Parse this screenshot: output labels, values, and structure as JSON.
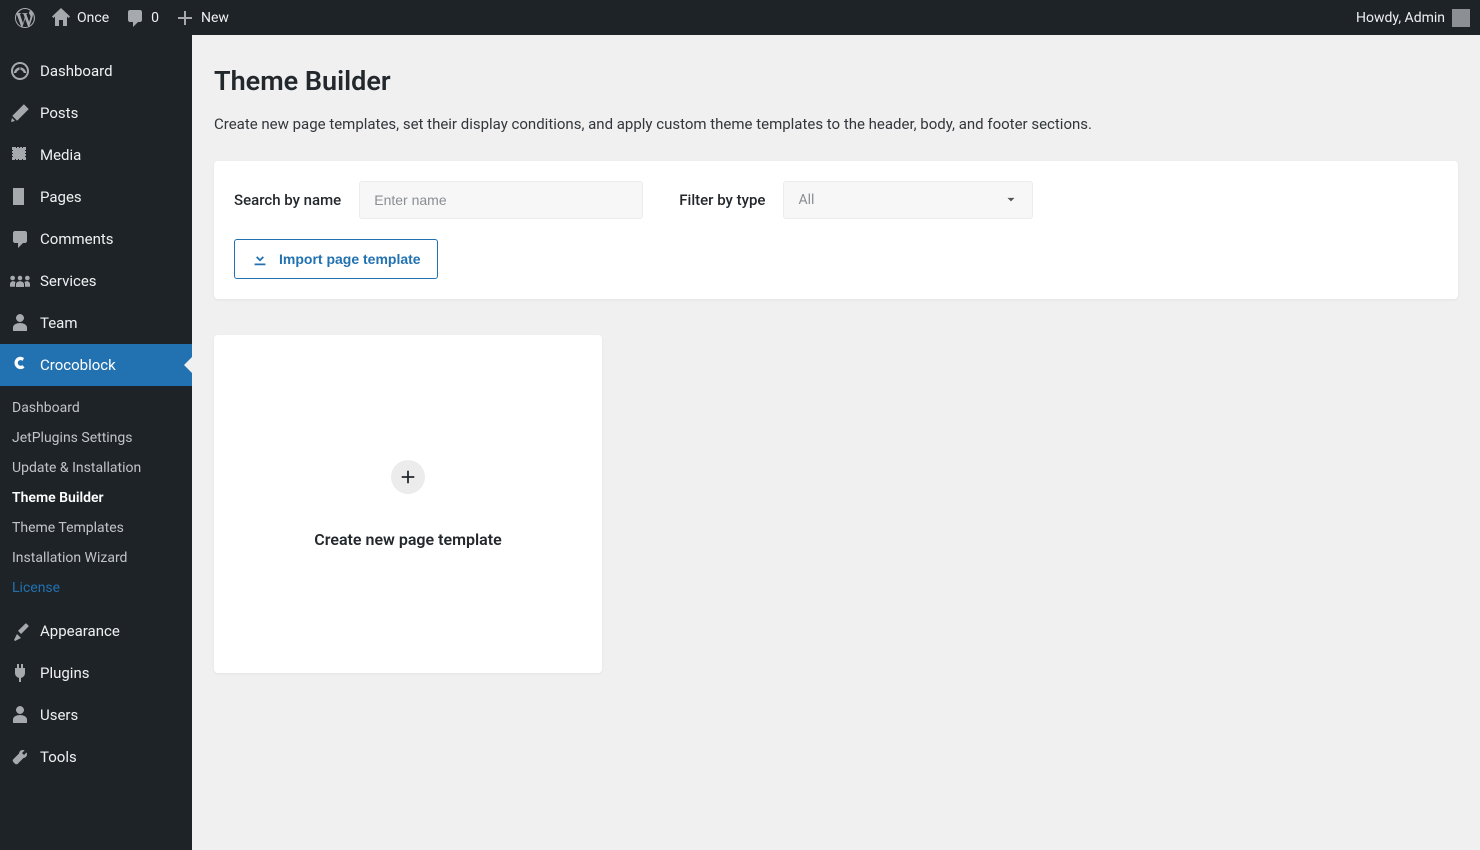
{
  "adminbar": {
    "site_name": "Once",
    "comments_count": "0",
    "new_label": "New",
    "howdy": "Howdy, Admin"
  },
  "sidebar": {
    "items": [
      {
        "label": "Dashboard",
        "icon": "dashboard"
      },
      {
        "label": "Posts",
        "icon": "posts"
      },
      {
        "label": "Media",
        "icon": "media"
      },
      {
        "label": "Pages",
        "icon": "pages"
      },
      {
        "label": "Comments",
        "icon": "comments"
      },
      {
        "label": "Services",
        "icon": "services"
      },
      {
        "label": "Team",
        "icon": "team"
      },
      {
        "label": "Crocoblock",
        "icon": "crocoblock",
        "active": true
      },
      {
        "label": "Appearance",
        "icon": "appearance"
      },
      {
        "label": "Plugins",
        "icon": "plugins"
      },
      {
        "label": "Users",
        "icon": "users"
      },
      {
        "label": "Tools",
        "icon": "tools"
      }
    ],
    "submenu": [
      {
        "label": "Dashboard"
      },
      {
        "label": "JetPlugins Settings"
      },
      {
        "label": "Update & Installation"
      },
      {
        "label": "Theme Builder",
        "current": true
      },
      {
        "label": "Theme Templates"
      },
      {
        "label": "Installation Wizard"
      },
      {
        "label": "License",
        "highlight": true
      }
    ]
  },
  "page": {
    "title": "Theme Builder",
    "description": "Create new page templates, set their display conditions, and apply custom theme templates to the header, body, and footer sections."
  },
  "filters": {
    "search_label": "Search by name",
    "search_placeholder": "Enter name",
    "type_label": "Filter by type",
    "type_value": "All",
    "import_label": "Import page template"
  },
  "create_card": {
    "label": "Create new page template"
  }
}
